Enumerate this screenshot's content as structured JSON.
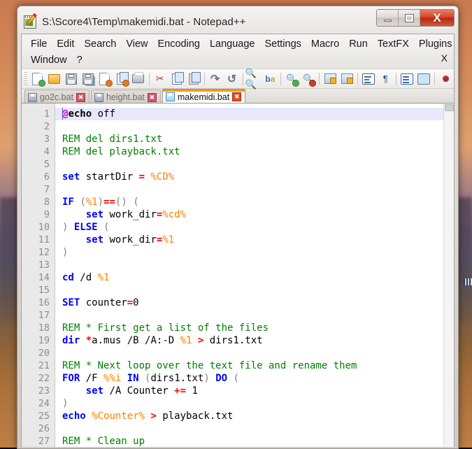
{
  "window": {
    "title": "S:\\Score4\\Temp\\makemidi.bat - Notepad++",
    "app_icon": "notepad-plus-plus-icon",
    "controls": {
      "minimize": "–",
      "maximize": "□",
      "close": "X"
    }
  },
  "menubar": {
    "row1": [
      "File",
      "Edit",
      "Search",
      "View",
      "Encoding",
      "Language",
      "Settings",
      "Macro",
      "Run",
      "TextFX",
      "Plugins"
    ],
    "row2": [
      "Window",
      "?"
    ],
    "close_doc_label": "X"
  },
  "toolbar": {
    "icons": [
      "new-file-icon",
      "open-file-icon",
      "save-icon",
      "save-all-icon",
      "close-file-icon",
      "close-all-files-icon",
      "print-icon",
      "cut-icon",
      "copy-icon",
      "paste-icon",
      "undo-icon",
      "redo-icon",
      "find-icon",
      "replace-icon",
      "zoom-in-icon",
      "zoom-out-icon",
      "sync-vertical-scroll-icon",
      "sync-horizontal-scroll-icon",
      "word-wrap-icon",
      "show-all-characters-icon",
      "indent-guide-icon",
      "user-defined-language-icon",
      "start-record-macro-icon"
    ],
    "overflow_label": "»"
  },
  "tabs": [
    {
      "label": "go2c.bat",
      "active": false,
      "close_label": "✖"
    },
    {
      "label": "height.bat",
      "active": false,
      "close_label": "✖"
    },
    {
      "label": "makemidi.bat",
      "active": true,
      "close_label": "✖"
    }
  ],
  "editor": {
    "current_line": 1,
    "colors": {
      "keyword": "#0000ff",
      "comment": "#008000",
      "variable": "#ff8000",
      "operator": "#ff0000",
      "at_symbol": "#cc00cc",
      "current_line_bg": "#e8e8fb",
      "gutter_bg": "#e9e9e9"
    },
    "line_numbers": [
      1,
      2,
      3,
      4,
      5,
      6,
      7,
      8,
      9,
      10,
      11,
      12,
      13,
      14,
      15,
      16,
      17,
      18,
      19,
      20,
      21,
      22,
      23,
      24,
      25,
      26,
      27
    ],
    "lines": [
      {
        "n": 1,
        "text": "@echo off"
      },
      {
        "n": 2,
        "text": ""
      },
      {
        "n": 3,
        "text": "REM del dirs1.txt"
      },
      {
        "n": 4,
        "text": "REM del playback.txt"
      },
      {
        "n": 5,
        "text": ""
      },
      {
        "n": 6,
        "text": "set startDir = %CD%"
      },
      {
        "n": 7,
        "text": ""
      },
      {
        "n": 8,
        "text": "IF (%1)==() ("
      },
      {
        "n": 9,
        "text": "    set work_dir=%cd%"
      },
      {
        "n": 10,
        "text": ") ELSE ("
      },
      {
        "n": 11,
        "text": "    set work_dir=%1"
      },
      {
        "n": 12,
        "text": ")"
      },
      {
        "n": 13,
        "text": ""
      },
      {
        "n": 14,
        "text": "cd /d %1"
      },
      {
        "n": 15,
        "text": ""
      },
      {
        "n": 16,
        "text": "SET counter=0"
      },
      {
        "n": 17,
        "text": ""
      },
      {
        "n": 18,
        "text": "REM * First get a list of the files"
      },
      {
        "n": 19,
        "text": "dir *a.mus /B /A:-D %1 > dirs1.txt"
      },
      {
        "n": 20,
        "text": ""
      },
      {
        "n": 21,
        "text": "REM * Next loop over the text file and rename them"
      },
      {
        "n": 22,
        "text": "FOR /F %%i IN (dirs1.txt) DO ("
      },
      {
        "n": 23,
        "text": "    set /A Counter += 1"
      },
      {
        "n": 24,
        "text": ")"
      },
      {
        "n": 25,
        "text": "echo %Counter% > playback.txt"
      },
      {
        "n": 26,
        "text": ""
      },
      {
        "n": 27,
        "text": "REM * Clean up"
      }
    ]
  }
}
